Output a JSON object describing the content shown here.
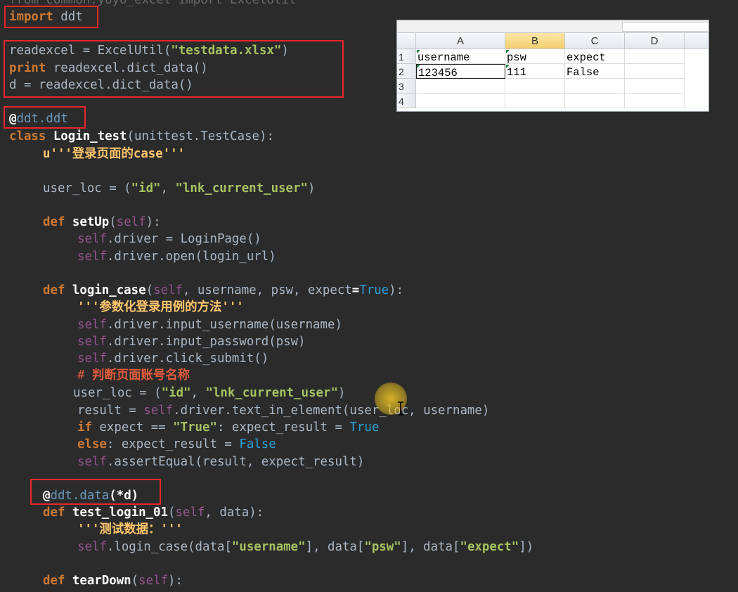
{
  "code": {
    "l0_text": "from common.yoyo_excel import ExcelUtil",
    "l1": [
      "import",
      " ddt"
    ],
    "l2": [
      "readexcel = ExcelUtil(",
      "\"testdata.xlsx\"",
      ")"
    ],
    "l3": [
      "print",
      " readexcel.dict_data()"
    ],
    "l4": "d = readexcel.dict_data()",
    "l5": [
      "@",
      "ddt.ddt"
    ],
    "l6": [
      "class ",
      "Login_test",
      "(unittest.TestCase):"
    ],
    "l7": [
      "u'''",
      "登录页面的",
      "case'''"
    ],
    "l8": [
      "user_loc = (",
      "\"id\"",
      ", ",
      "\"lnk_current_user\"",
      ")"
    ],
    "l9": [
      "def ",
      "setUp",
      "(",
      "self",
      "):"
    ],
    "l10": [
      "self",
      ".driver = LoginPage()"
    ],
    "l11": [
      "self",
      ".driver.open(login_url)"
    ],
    "l12": [
      "def ",
      "login_case",
      "(",
      "self",
      ", username, psw, expect",
      "=",
      "True",
      "):"
    ],
    "l13": [
      "'''",
      "参数化登录用例的方法",
      "'''"
    ],
    "l14": [
      "self",
      ".driver.input_username(username)"
    ],
    "l15": [
      "self",
      ".driver.input_password(psw)"
    ],
    "l16": [
      "self",
      ".driver.click_submit()"
    ],
    "l17": [
      "# ",
      "判断页面账号名称"
    ],
    "l18": [
      "user_loc = (",
      "\"id\"",
      ", ",
      "\"lnk_current_user\"",
      ")"
    ],
    "l19": [
      "result = ",
      "self",
      ".driver.text_in_element(user_loc, username)"
    ],
    "l20": [
      "if",
      " expect == ",
      "\"True\"",
      ": expect_result = ",
      "True"
    ],
    "l21": [
      "else",
      ": expect_result = ",
      "False"
    ],
    "l22": [
      "self",
      ".assertEqual(result, expect_result)"
    ],
    "l23": [
      "@",
      "ddt.data",
      "(*d)"
    ],
    "l24": [
      "def ",
      "test_login_01",
      "(",
      "self",
      ", data):"
    ],
    "l25": [
      "'''",
      "测试数据：",
      "'''"
    ],
    "l26": [
      "self",
      ".login_case(data[",
      "\"username\"",
      "], data[",
      "\"psw\"",
      "], data[",
      "\"expect\"",
      "])"
    ],
    "l27": [
      "def ",
      "tearDown",
      "(",
      "self",
      "):"
    ]
  },
  "spreadsheet": {
    "columns": [
      "A",
      "B",
      "C",
      "D"
    ],
    "selected_column": "B",
    "rows": [
      "1",
      "2",
      "3",
      "4"
    ],
    "cells": [
      [
        "username",
        "psw",
        "expect",
        ""
      ],
      [
        "123456",
        "111",
        "False",
        ""
      ],
      [
        "",
        "",
        "",
        ""
      ],
      [
        "",
        "",
        "",
        ""
      ]
    ]
  },
  "colors": {
    "background": "#2b2b2b",
    "keyword": "#cc7832",
    "string": "#a5c261",
    "docstring": "#ffc66d",
    "self": "#94558d",
    "builtin_const": "#2aa1d3",
    "decorator": "#6897bb",
    "comment": "#e35c3e",
    "annotation_box": "#e8262c"
  }
}
